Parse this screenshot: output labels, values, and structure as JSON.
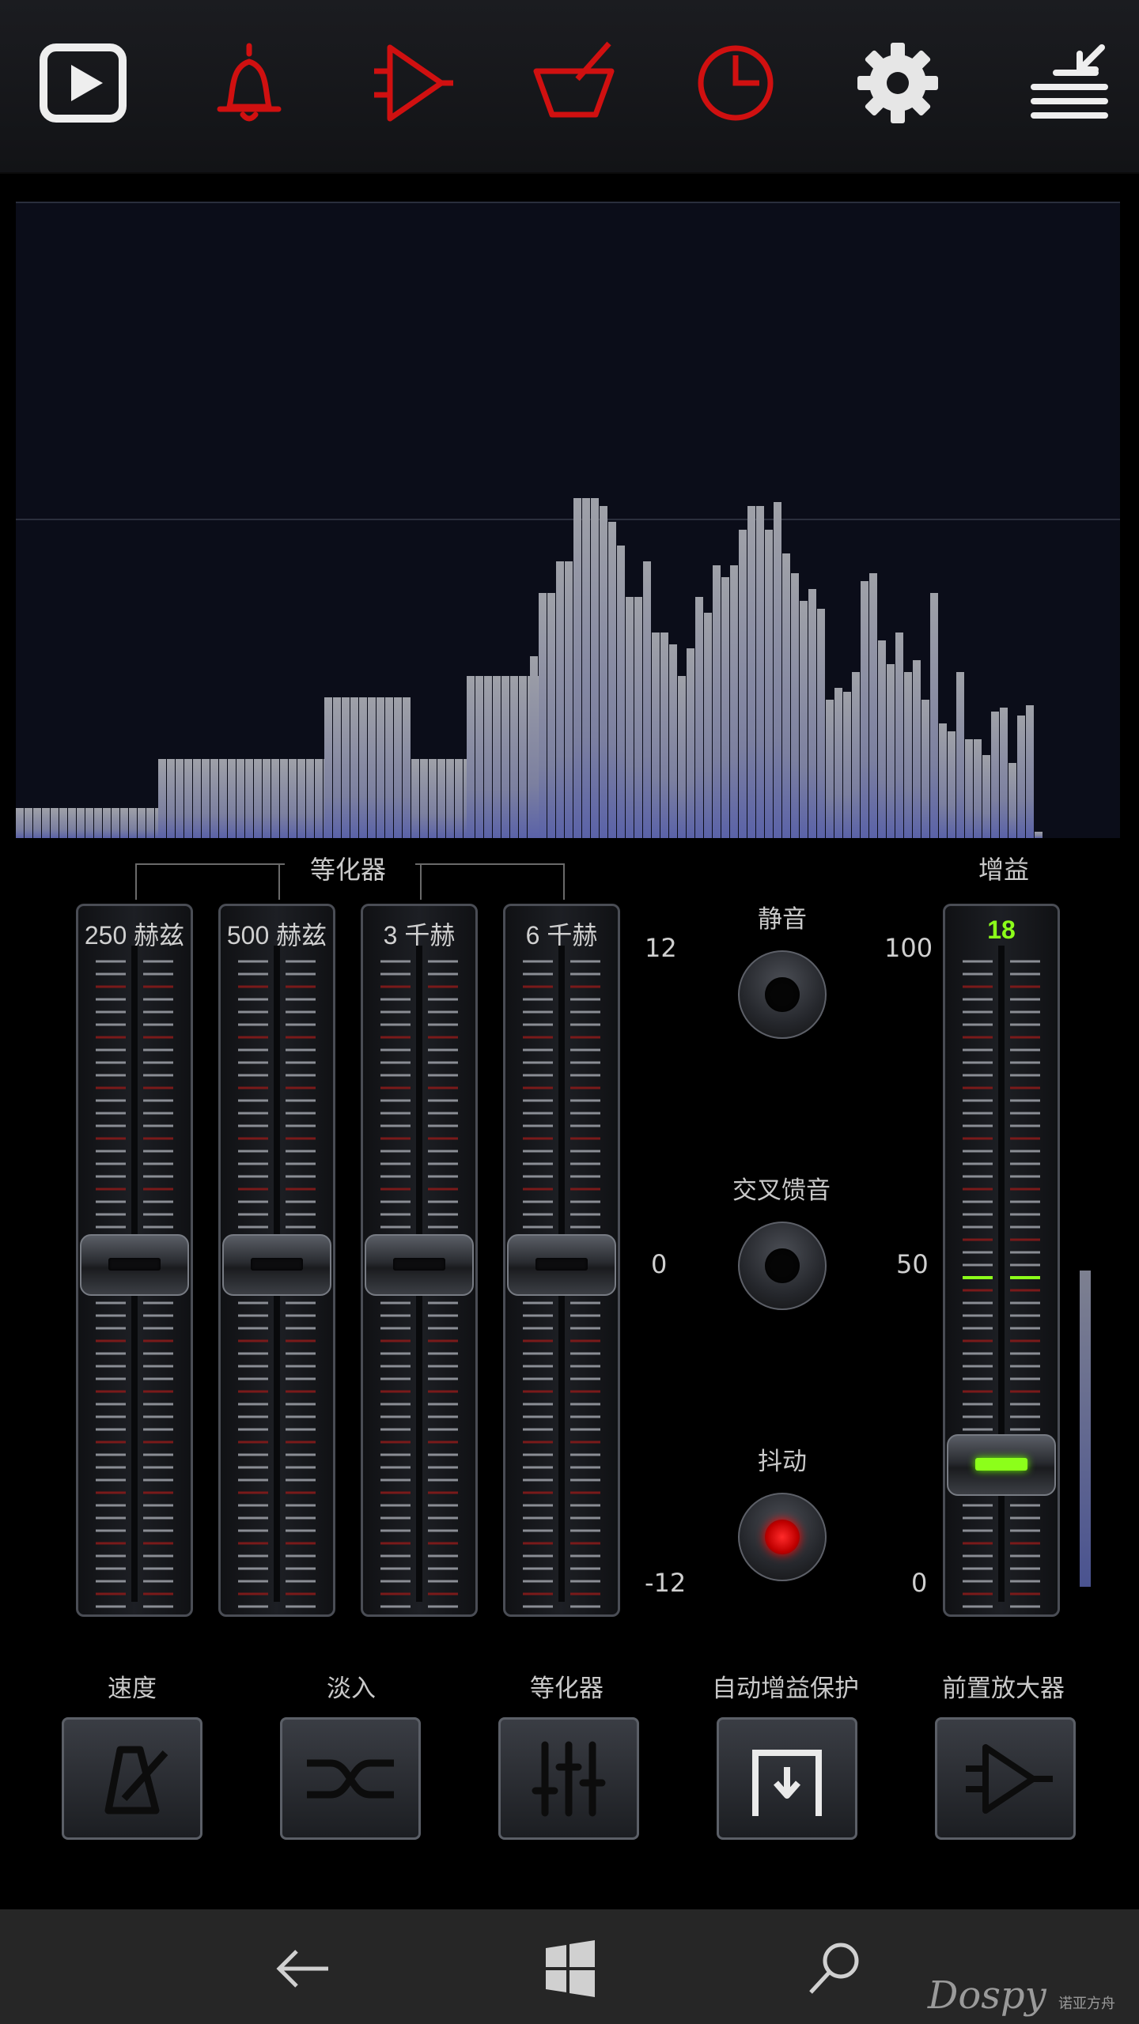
{
  "toolbar": {
    "icons": [
      "play-icon",
      "bell-icon",
      "amplifier-icon",
      "mortar-icon",
      "timer-icon",
      "gear-icon",
      "menu-collapse-icon"
    ],
    "accent_color": "#d01010"
  },
  "eq_group_label": "等化器",
  "gain_label": "增益",
  "sliders": [
    {
      "freq": "250 赫兹",
      "value_db": 0
    },
    {
      "freq": "500 赫兹",
      "value_db": 0
    },
    {
      "freq": "3 千赫",
      "value_db": 0
    },
    {
      "freq": "6 千赫",
      "value_db": 0
    }
  ],
  "eq_scale": {
    "top": "12",
    "mid": "0",
    "bottom": "-12"
  },
  "gain_scale": {
    "top": "100",
    "mid": "50",
    "bottom": "0"
  },
  "gain": {
    "value": "18",
    "level_fraction": 0.18
  },
  "toggles": [
    {
      "label": "静音",
      "on": false
    },
    {
      "label": "交叉馈音",
      "on": false
    },
    {
      "label": "抖动",
      "on": true
    }
  ],
  "bottom_buttons": [
    {
      "label": "速度",
      "icon": "metronome-icon"
    },
    {
      "label": "淡入",
      "icon": "crossfade-icon"
    },
    {
      "label": "等化器",
      "icon": "equalizer-icon"
    },
    {
      "label": "自动增益保护",
      "icon": "gain-protect-icon"
    },
    {
      "label": "前置放大器",
      "icon": "preamp-icon"
    }
  ],
  "navbar": {
    "icons": [
      "back-arrow-icon",
      "windows-icon",
      "search-icon"
    ]
  },
  "watermark": {
    "brand": "Dospy",
    "sub": "诺亚方舟"
  }
}
